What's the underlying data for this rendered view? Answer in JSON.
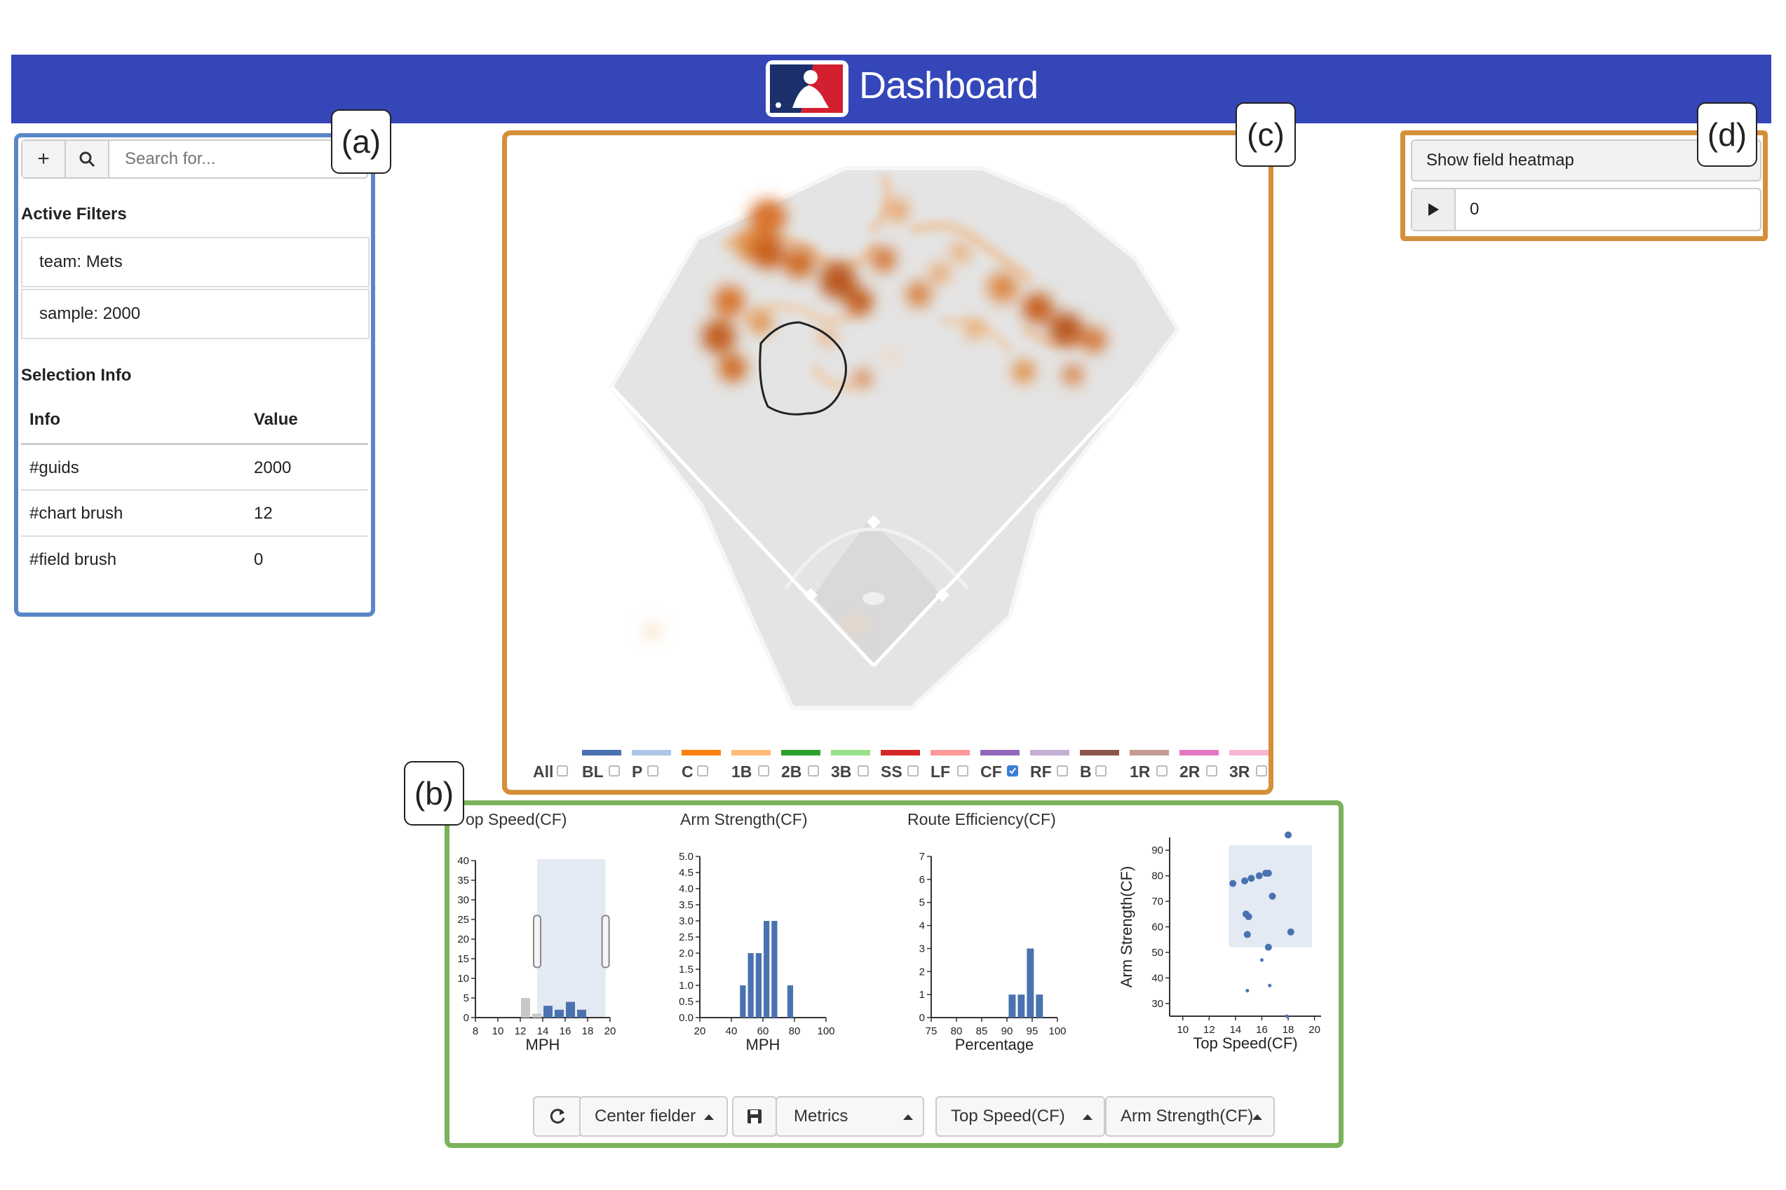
{
  "header": {
    "title": "Dashboard"
  },
  "labels": {
    "a": "(a)",
    "b": "(b)",
    "c": "(c)",
    "d": "(d)"
  },
  "panel_a": {
    "add_icon": "+",
    "search_placeholder": "Search for...",
    "active_filters_title": "Active Filters",
    "filters": [
      "team: Mets",
      "sample: 2000"
    ],
    "selection_info_title": "Selection Info",
    "table": {
      "headers": [
        "Info",
        "Value"
      ],
      "rows": [
        [
          "#guids",
          "2000"
        ],
        [
          "#chart brush",
          "12"
        ],
        [
          "#field brush",
          "0"
        ]
      ]
    }
  },
  "panel_d": {
    "heatmap_button": "Show field heatmap",
    "frame_value": "0"
  },
  "legend": {
    "all_label": "All",
    "items": [
      {
        "label": "BL",
        "color": "#4a72b0",
        "checked": false
      },
      {
        "label": "P",
        "color": "#aec7e8",
        "checked": false
      },
      {
        "label": "C",
        "color": "#ff7f0e",
        "checked": false
      },
      {
        "label": "1B",
        "color": "#ffbb78",
        "checked": false
      },
      {
        "label": "2B",
        "color": "#2ca02c",
        "checked": false
      },
      {
        "label": "3B",
        "color": "#98df8a",
        "checked": false
      },
      {
        "label": "SS",
        "color": "#d62728",
        "checked": false
      },
      {
        "label": "LF",
        "color": "#ff9896",
        "checked": false
      },
      {
        "label": "CF",
        "color": "#9467bd",
        "checked": true
      },
      {
        "label": "RF",
        "color": "#c5b0d5",
        "checked": false
      },
      {
        "label": "B",
        "color": "#8c564b",
        "checked": false
      },
      {
        "label": "1R",
        "color": "#c49c94",
        "checked": false
      },
      {
        "label": "2R",
        "color": "#e377c2",
        "checked": false
      },
      {
        "label": "3R",
        "color": "#f7b6d2",
        "checked": false
      }
    ]
  },
  "controls": {
    "position_dropdown": "Center fielder",
    "metrics_dropdown": "Metrics",
    "x_metric_dropdown": "Top Speed(CF)",
    "y_metric_dropdown": "Arm Strength(CF)"
  },
  "chart_data": [
    {
      "type": "bar",
      "title": "Top Speed(CF)",
      "visible_title": "op Speed(CF)",
      "xlabel": "MPH",
      "ylabel": "",
      "x_ticks": [
        8,
        10,
        12,
        14,
        16,
        18,
        20
      ],
      "y_ticks": [
        0,
        5,
        10,
        15,
        20,
        25,
        30,
        35,
        40
      ],
      "xlim": [
        8,
        20
      ],
      "ylim": [
        0,
        40
      ],
      "bin_width": 1,
      "bins_x": [
        12,
        13,
        14,
        15,
        16,
        17
      ],
      "values": [
        5,
        1,
        3,
        2,
        4,
        2
      ],
      "selected": [
        false,
        false,
        true,
        true,
        true,
        true
      ],
      "brush": [
        13.5,
        19.6
      ]
    },
    {
      "type": "bar",
      "title": "Arm Strength(CF)",
      "xlabel": "MPH",
      "ylabel": "",
      "x_ticks": [
        20,
        40,
        60,
        80,
        100
      ],
      "y_ticks": [
        "0.0",
        "0.5",
        "1.0",
        "1.5",
        "2.0",
        "2.5",
        "3.0",
        "3.5",
        "4.0",
        "4.5",
        "5.0"
      ],
      "xlim": [
        20,
        100
      ],
      "ylim": [
        0,
        5
      ],
      "bin_width": 5,
      "bins_x": [
        45,
        50,
        55,
        60,
        65,
        70,
        75,
        80,
        85,
        90
      ],
      "values": [
        1,
        2,
        2,
        3,
        3,
        0,
        1,
        0,
        0,
        0
      ]
    },
    {
      "type": "bar",
      "title": "Route Efficiency(CF)",
      "xlabel": "Percentage",
      "ylabel": "",
      "x_ticks": [
        75,
        80,
        85,
        90,
        95,
        100
      ],
      "y_ticks": [
        0,
        1,
        2,
        3,
        4,
        5,
        6,
        7
      ],
      "xlim": [
        75,
        100
      ],
      "ylim": [
        0,
        7
      ],
      "bin_width": 1.8,
      "bins_x": [
        90.2,
        92.0,
        93.8,
        95.6
      ],
      "values": [
        1,
        1,
        3,
        1
      ]
    },
    {
      "type": "scatter",
      "title": "",
      "xlabel": "Top Speed(CF)",
      "ylabel": "Arm Strength(CF)",
      "x_ticks": [
        10,
        12,
        14,
        16,
        18,
        20
      ],
      "y_ticks": [
        30,
        40,
        50,
        60,
        70,
        80,
        90
      ],
      "xlim": [
        9,
        20.5
      ],
      "ylim": [
        25,
        95
      ],
      "brush": {
        "x": [
          13.5,
          19.8
        ],
        "y": [
          52,
          92
        ]
      },
      "points_selected": [
        [
          18,
          96
        ],
        [
          15.8,
          80
        ],
        [
          15.2,
          79
        ],
        [
          14.7,
          78
        ],
        [
          16.3,
          81
        ],
        [
          16.5,
          81
        ],
        [
          13.8,
          77
        ],
        [
          16.8,
          72
        ],
        [
          14.8,
          65
        ],
        [
          15.0,
          64
        ],
        [
          14.9,
          57
        ],
        [
          18.2,
          58
        ],
        [
          16.5,
          52
        ]
      ],
      "points_unselected": [
        [
          16.0,
          47
        ],
        [
          14.9,
          35
        ],
        [
          16.6,
          37
        ],
        [
          17.9,
          25
        ]
      ]
    }
  ]
}
